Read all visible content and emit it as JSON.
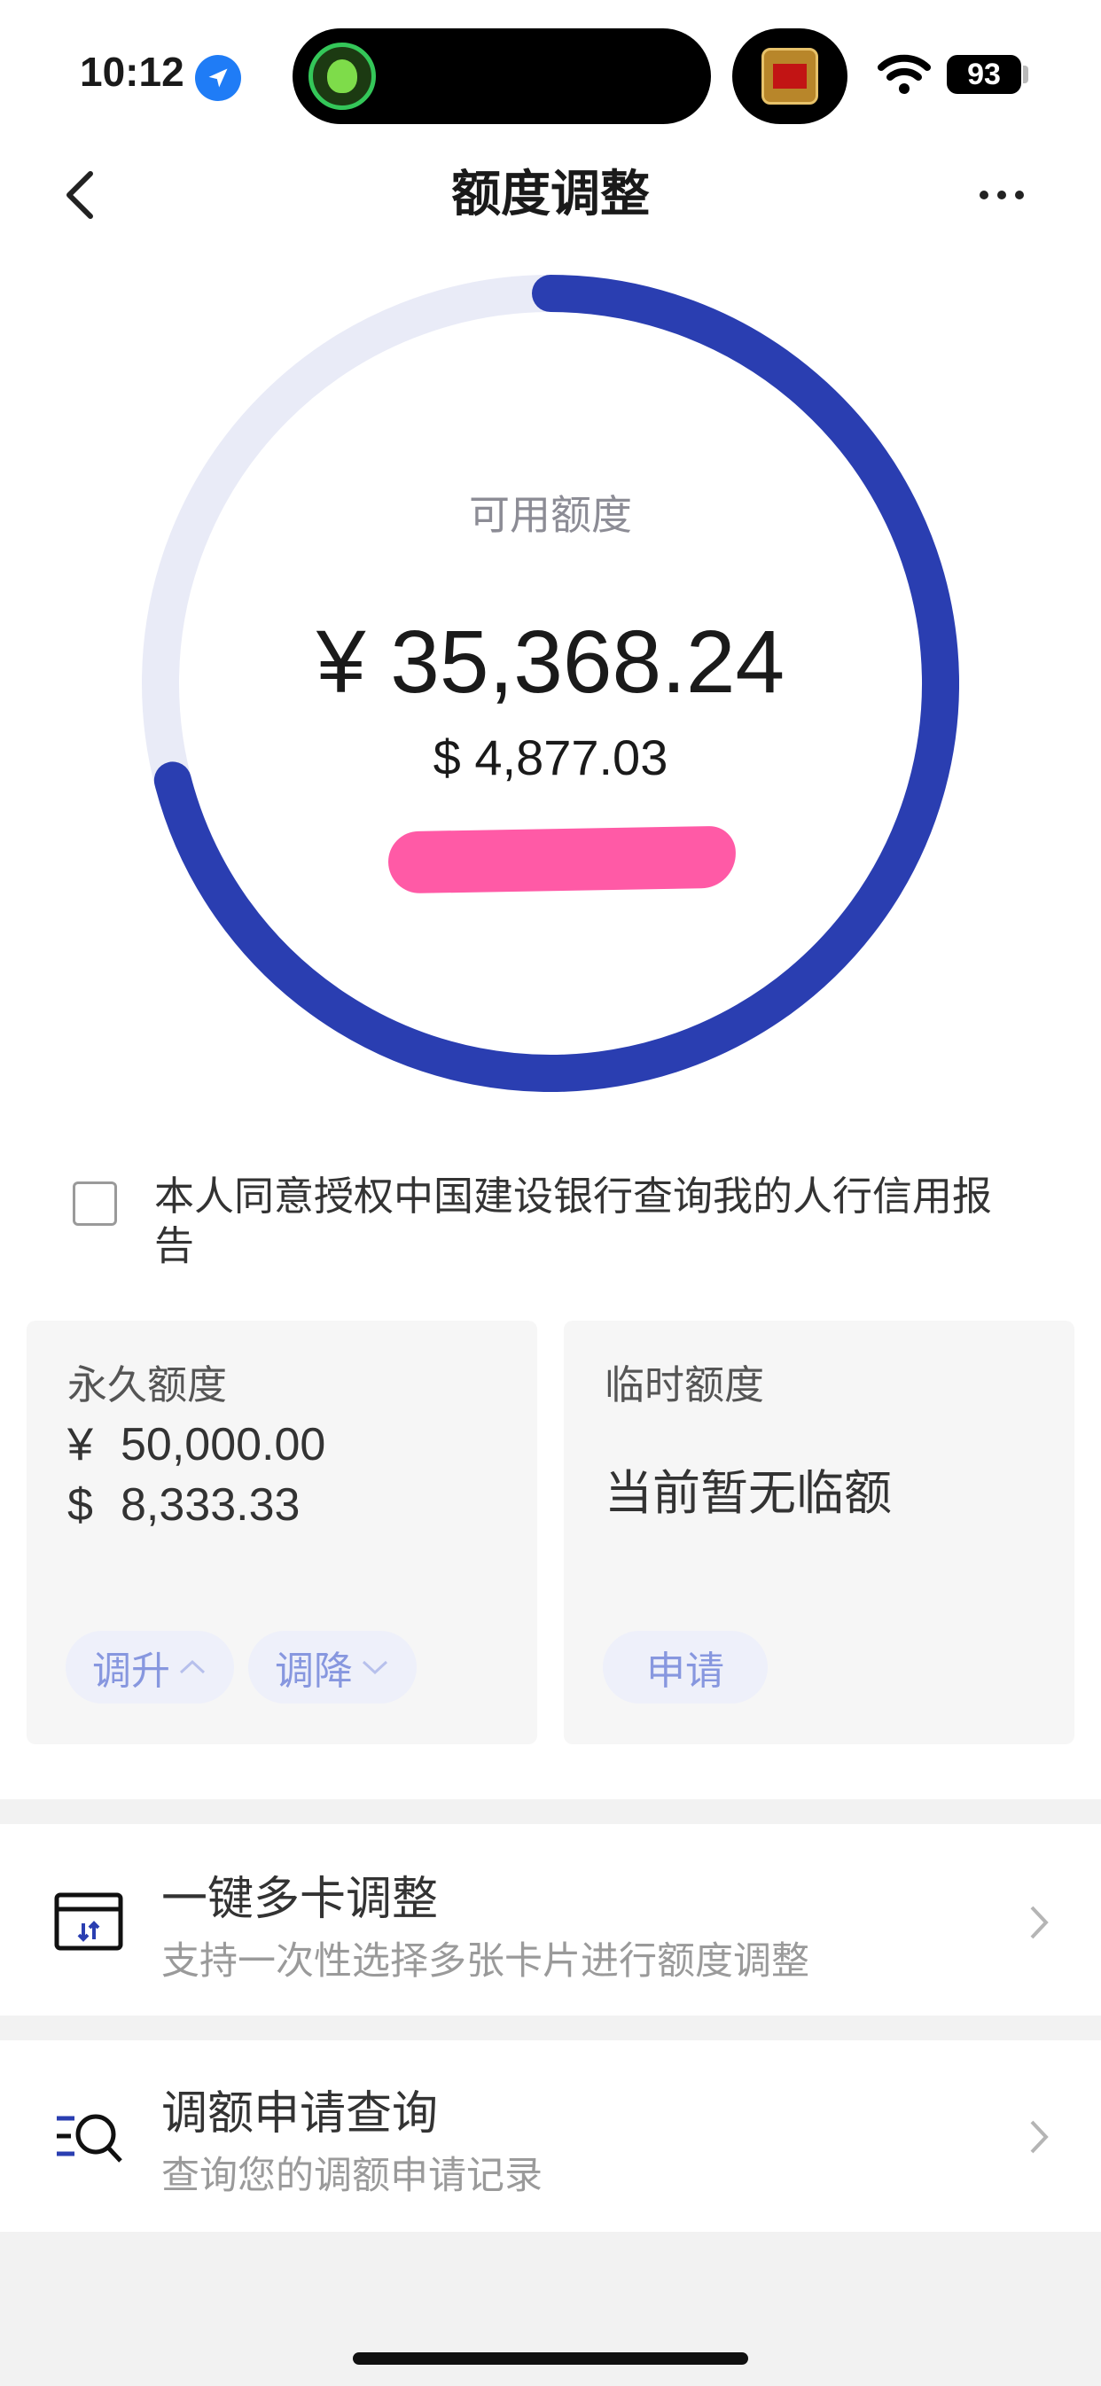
{
  "status_bar": {
    "time": "10:12",
    "battery": "93"
  },
  "header": {
    "title": "额度调整"
  },
  "gauge": {
    "label": "可用额度",
    "amount_cny": "¥ 35,368.24",
    "amount_usd": "$ 4,877.03",
    "available_fraction": 0.71,
    "track_color": "#e9ebf7",
    "fill_color": "#2a3eb1"
  },
  "consent": {
    "text": "本人同意授权中国建设银行查询我的人行信用报告"
  },
  "permanent": {
    "title": "永久额度",
    "cny_symbol": "¥",
    "cny_value": "50,000.00",
    "usd_symbol": "$",
    "usd_value": "8,333.33",
    "raise_label": "调升",
    "lower_label": "调降"
  },
  "temporary": {
    "title": "临时额度",
    "status": "当前暂无临额",
    "apply_label": "申请"
  },
  "list": [
    {
      "title": "一键多卡调整",
      "subtitle": "支持一次性选择多张卡片进行额度调整",
      "icon": "card-adjust-icon"
    },
    {
      "title": "调额申请查询",
      "subtitle": "查询您的调额申请记录",
      "icon": "search-list-icon"
    }
  ]
}
